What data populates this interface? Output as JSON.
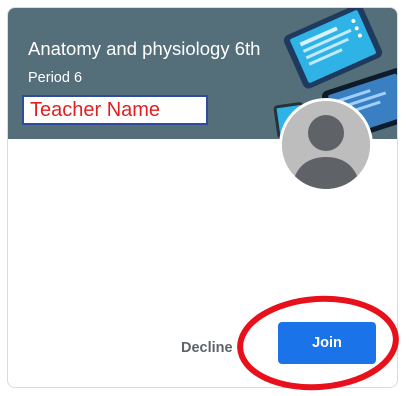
{
  "class_card": {
    "title": "Anatomy and physiology 6th",
    "section": "Period 6",
    "teacher_name": "Teacher Name",
    "banner_color": "#546e7a",
    "avatar_icon": "person-avatar-icon",
    "actions": {
      "decline_label": "Decline",
      "join_label": "Join"
    }
  },
  "colors": {
    "join_button": "#1a73e8",
    "teacher_label_text": "#e02020",
    "annotation_circle": "#e8111b"
  }
}
